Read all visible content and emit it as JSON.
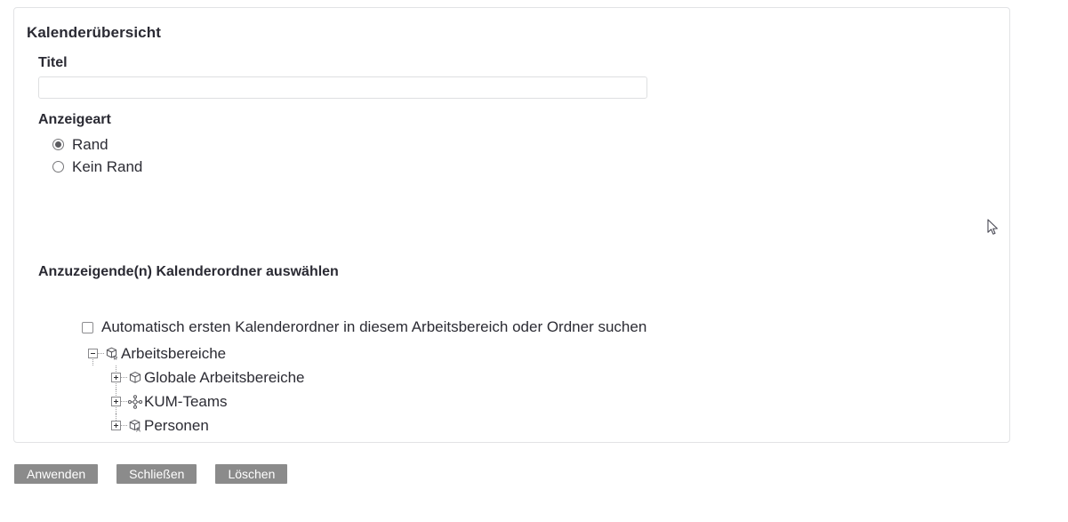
{
  "panel": {
    "title": "Kalenderübersicht",
    "title_field": {
      "label": "Titel",
      "value": "",
      "placeholder": ""
    },
    "display_mode": {
      "label": "Anzeigeart",
      "options": [
        {
          "label": "Rand",
          "selected": true
        },
        {
          "label": "Kein Rand",
          "selected": false
        }
      ]
    },
    "folder_picker": {
      "heading": "Anzuzeigende(n) Kalenderordner auswählen",
      "auto_checkbox": {
        "label": "Automatisch ersten Kalenderordner in diesem Arbeitsbereich oder Ordner suchen",
        "checked": false
      },
      "tree": [
        {
          "label": "Arbeitsbereiche",
          "icon": "cube-star-icon",
          "expander": "minus",
          "level": 1
        },
        {
          "label": "Globale Arbeitsbereiche",
          "icon": "cube-icon",
          "expander": "plus",
          "level": 2
        },
        {
          "label": "KUM-Teams",
          "icon": "network-nodes-icon",
          "expander": "plus",
          "level": 2
        },
        {
          "label": "Personen",
          "icon": "cube-person-icon",
          "expander": "plus",
          "level": 2
        }
      ]
    }
  },
  "footer": {
    "buttons": [
      {
        "label": "Anwenden"
      },
      {
        "label": "Schließen"
      },
      {
        "label": "Löschen"
      }
    ]
  },
  "colors": {
    "panel_border": "#e2e3e5",
    "text": "#2c2c34",
    "button_bg": "#8b8b8b",
    "button_text": "#ffffff",
    "input_border": "#dedfe1"
  }
}
